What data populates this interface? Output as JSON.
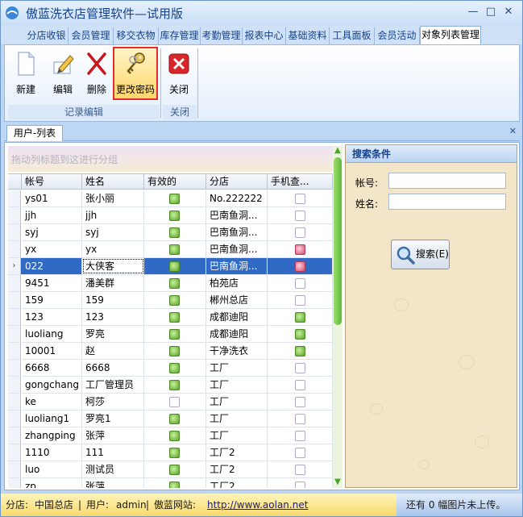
{
  "window": {
    "title": "傲蓝洗衣店管理软件—试用版",
    "controls": [
      "minimize-icon",
      "maximize-icon",
      "close-icon"
    ]
  },
  "tabs": [
    {
      "label": "分店收银",
      "active": false
    },
    {
      "label": "会员管理",
      "active": false
    },
    {
      "label": "移交衣物",
      "active": false
    },
    {
      "label": "库存管理",
      "active": false
    },
    {
      "label": "考勤管理",
      "active": false
    },
    {
      "label": "报表中心",
      "active": false
    },
    {
      "label": "基础资料",
      "active": false
    },
    {
      "label": "工具面板",
      "active": false
    },
    {
      "label": "会员活动",
      "active": false
    },
    {
      "label": "对象列表管理",
      "active": true
    }
  ],
  "ribbon": {
    "buttons": [
      {
        "label": "新建",
        "icon": "new-document-icon",
        "highlighted": false
      },
      {
        "label": "编辑",
        "icon": "edit-pencil-icon",
        "highlighted": false
      },
      {
        "label": "删除",
        "icon": "delete-x-icon",
        "highlighted": false
      },
      {
        "label": "更改密码",
        "icon": "keys-icon",
        "highlighted": true
      },
      {
        "label": "关闭",
        "icon": "close-red-icon",
        "highlighted": false
      }
    ],
    "groups": [
      "记录编辑",
      "关闭"
    ]
  },
  "doc_tab": {
    "label": "用户-列表",
    "close_icon": "close-icon"
  },
  "grid": {
    "group_hint": "拖动列标题到这进行分组",
    "columns": [
      "帐号",
      "姓名",
      "有效的",
      "分店",
      "手机查..."
    ],
    "rows": [
      {
        "account": "ys01",
        "name": "张小丽",
        "valid": true,
        "branch": "No.222222",
        "mobile": false,
        "selected": false
      },
      {
        "account": "jjh",
        "name": "jjh",
        "valid": true,
        "branch": "巴南鱼洞...",
        "mobile": false,
        "selected": false
      },
      {
        "account": "syj",
        "name": "syj",
        "valid": true,
        "branch": "巴南鱼洞...",
        "mobile": false,
        "selected": false
      },
      {
        "account": "yx",
        "name": "yx",
        "valid": true,
        "branch": "巴南鱼洞...",
        "mobile": true,
        "selected": false
      },
      {
        "account": "022",
        "name": "大侠客",
        "valid": true,
        "branch": "巴南鱼洞...",
        "mobile": true,
        "selected": true
      },
      {
        "account": "9451",
        "name": "潘美群",
        "valid": true,
        "branch": "柏苑店",
        "mobile": false,
        "selected": false
      },
      {
        "account": "159",
        "name": "159",
        "valid": true,
        "branch": "郴州总店",
        "mobile": false,
        "selected": false
      },
      {
        "account": "123",
        "name": "123",
        "valid": true,
        "branch": "成都迪阳",
        "mobile": true,
        "selected": false
      },
      {
        "account": "luoliang",
        "name": "罗亮",
        "valid": true,
        "branch": "成都迪阳",
        "mobile": true,
        "selected": false
      },
      {
        "account": "10001",
        "name": "赵",
        "valid": true,
        "branch": "干净洗衣",
        "mobile": true,
        "selected": false
      },
      {
        "account": "6668",
        "name": "6668",
        "valid": true,
        "branch": "工厂",
        "mobile": false,
        "selected": false
      },
      {
        "account": "gongchang",
        "name": "工厂管理员",
        "valid": true,
        "branch": "工厂",
        "mobile": false,
        "selected": false
      },
      {
        "account": "ke",
        "name": "柯莎",
        "valid": false,
        "branch": "工厂",
        "mobile": false,
        "selected": false
      },
      {
        "account": "luoliang1",
        "name": "罗亮1",
        "valid": true,
        "branch": "工厂",
        "mobile": false,
        "selected": false
      },
      {
        "account": "zhangping",
        "name": "张萍",
        "valid": true,
        "branch": "工厂",
        "mobile": false,
        "selected": false
      },
      {
        "account": "1110",
        "name": "111",
        "valid": true,
        "branch": "工厂2",
        "mobile": false,
        "selected": false
      },
      {
        "account": "luo",
        "name": "测试员",
        "valid": true,
        "branch": "工厂2",
        "mobile": false,
        "selected": false
      },
      {
        "account": "zp",
        "name": "张萍",
        "valid": true,
        "branch": "工厂2",
        "mobile": false,
        "selected": false
      }
    ]
  },
  "search": {
    "title": "搜索条件",
    "account_label": "帐号:",
    "account_value": "",
    "name_label": "姓名:",
    "name_value": "",
    "button_label": "搜索(E)"
  },
  "status": {
    "branch_label": "分店:",
    "branch_value": "中国总店",
    "user_label": "用户:",
    "user_value": "admin",
    "site_label": "傲蓝网站:",
    "site_url": "http://www.aolan.net",
    "upload_prefix": "还有",
    "upload_count": "0",
    "upload_suffix": "幅图片未上传。"
  },
  "colors": {
    "selection": "#316ac5",
    "accent": "#15428b",
    "highlight_border": "#e62d2d"
  }
}
